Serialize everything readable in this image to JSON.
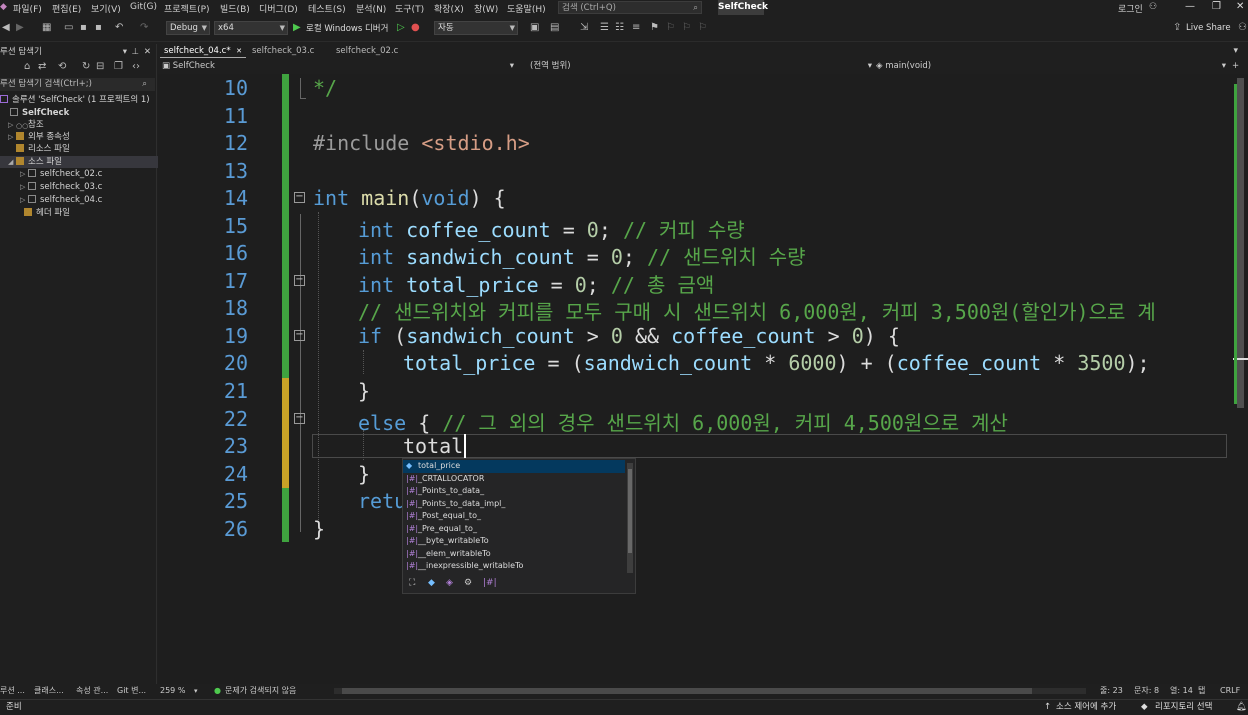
{
  "menubar": {
    "items": [
      "파일(F)",
      "편집(E)",
      "보기(V)",
      "Git(G)",
      "프로젝트(P)",
      "빌드(B)",
      "디버그(D)",
      "테스트(S)",
      "분석(N)",
      "도구(T)",
      "확장(X)",
      "창(W)",
      "도움말(H)"
    ],
    "search_placeholder": "검색 (Ctrl+Q)",
    "solution_name": "SelfCheck",
    "login": "로그인"
  },
  "toolbar": {
    "config": "Debug",
    "platform": "x64",
    "run_label": "로컬 Windows 디버거",
    "auto": "자동",
    "live_share": "Live Share"
  },
  "explorer": {
    "title": "루션 탐색기",
    "search": "루션 탐색기 검색(Ctrl+;)",
    "items": [
      {
        "label": "솔루션 'SelfCheck' (1 프로젝트의 1)"
      },
      {
        "label": "SelfCheck"
      },
      {
        "label": "참조"
      },
      {
        "label": "외부 종속성"
      },
      {
        "label": "리소스 파일"
      },
      {
        "label": "소스 파일"
      },
      {
        "label": "selfcheck_02.c"
      },
      {
        "label": "selfcheck_03.c"
      },
      {
        "label": "selfcheck_04.c"
      },
      {
        "label": "헤더 파일"
      }
    ],
    "bottom_tabs": [
      "루션 ...",
      "클래스...",
      "속성 관...",
      "Git 변..."
    ]
  },
  "editor": {
    "tabs": [
      "selfcheck_04.c*",
      "selfcheck_03.c",
      "selfcheck_02.c"
    ],
    "nav_project": "SelfCheck",
    "nav_scope": "(전역 범위)",
    "nav_function": "main(void)",
    "line_numbers": [
      "10",
      "11",
      "12",
      "13",
      "14",
      "15",
      "16",
      "17",
      "18",
      "19",
      "20",
      "21",
      "22",
      "23",
      "24",
      "25",
      "26"
    ],
    "zoom": "259 %",
    "issues": "문제가 검색되지 않음",
    "line": "줄: 23",
    "col": "문자: 8",
    "pos": "열: 14",
    "tab_mode": "탭",
    "eol": "CRLF"
  },
  "code": {
    "l10": "*/",
    "l12a": "#include ",
    "l12b": "<stdio.h>",
    "l14kw": "int",
    "l14fn": "main",
    "l14b": "(",
    "l14kw2": "void",
    "l14c": ") {",
    "l15kw": "int",
    "l15v": "coffee_count",
    "l15e": " = ",
    "l15n": "0",
    "l15s": ";",
    "l15c": "// 커피 수량",
    "l16kw": "int",
    "l16v": "sandwich_count",
    "l16e": " = ",
    "l16n": "0",
    "l16s": ";",
    "l16c": "// 샌드위치 수량",
    "l17kw": "int",
    "l17v": "total_price",
    "l17e": " = ",
    "l17n": "0",
    "l17s": ";",
    "l17c": "// 총 금액",
    "l18c": "// 샌드위치와 커피를 모두 구매 시 샌드위치 6,000원, 커피 3,500원(할인가)으로 계",
    "l19kw": "if",
    "l19a": " (",
    "l19v": "sandwich_count",
    "l19b": " > ",
    "l19n": "0",
    "l19c": " && ",
    "l19v2": "coffee_count",
    "l19d": " > ",
    "l19n2": "0",
    "l19e": ") {",
    "l20v": "total_price",
    "l20a": " = (",
    "l20v2": "sandwich_count",
    "l20b": " * ",
    "l20n": "6000",
    "l20c": ") + (",
    "l20v3": "coffee_count",
    "l20d": " * ",
    "l20n2": "3500",
    "l20e": ");",
    "l21": "}",
    "l22kw": "else",
    "l22a": " { ",
    "l22c": "// 그 외의 경우 샌드위치 6,000원, 커피 4,500원으로 계산",
    "l23": "total",
    "l24": "}",
    "l25": "retu",
    "l26": "}"
  },
  "autocomplete": {
    "items": [
      "total_price",
      "_CRTALLOCATOR",
      "_Points_to_data_",
      "_Points_to_data_impl_",
      "_Post_equal_to_",
      "_Pre_equal_to_",
      "__byte_writableTo",
      "__elem_writableTo",
      "__inexpressible_writableTo"
    ]
  },
  "statusbar": {
    "ready": "준비",
    "source_control": "소스 제어에 추가",
    "repo": "리포지토리 선택"
  }
}
